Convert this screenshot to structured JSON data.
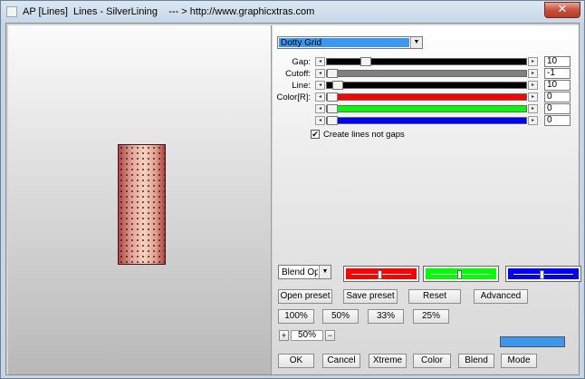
{
  "window": {
    "title": "AP [Lines]  Lines - SilverLining    --- > http://www.graphicxtras.com",
    "close_glyph": "✕"
  },
  "icons": {
    "app": "app-icon",
    "close": "close-icon",
    "dropdown": "chevron-down-icon",
    "left_arrow": "arrow-left-icon",
    "right_arrow": "arrow-right-icon",
    "check": "checkmark-icon"
  },
  "glyphs": {
    "down": "▼",
    "left": "◂",
    "right": "▸",
    "check": "✔"
  },
  "pattern_select": {
    "value": "Dotty Grid",
    "color": "#3a98f0"
  },
  "sliders": [
    {
      "label": "Gap:",
      "value": "10",
      "level": 0.18,
      "color": "#000000"
    },
    {
      "label": "Cutoff:",
      "value": "-1",
      "level": 0.0,
      "color": "#808080"
    },
    {
      "label": "Line:",
      "value": "10",
      "level": 0.03,
      "color": "#000000"
    },
    {
      "label": "Color[R]:",
      "value": "0",
      "level": 0.0,
      "color": "#ff0000"
    },
    {
      "label": "",
      "value": "0",
      "level": 0.0,
      "color": "#00ff00"
    },
    {
      "label": "",
      "value": "0",
      "level": 0.0,
      "color": "#0000ff"
    }
  ],
  "checkbox": {
    "label": "Create lines not gaps",
    "checked": true
  },
  "blend_select": {
    "value": "Blend Opti"
  },
  "color_blend": [
    {
      "color": "#ff0000",
      "level": 0.5
    },
    {
      "color": "#00ff00",
      "level": 0.5
    },
    {
      "color": "#0000ff",
      "level": 0.5
    }
  ],
  "buttons": {
    "open_preset": "Open preset",
    "save_preset": "Save preset",
    "reset": "Reset",
    "advanced": "Advanced",
    "z100": "100%",
    "z50": "50%",
    "z33": "33%",
    "z25": "25%",
    "plus": "+",
    "zoom_value": "50%",
    "minus": "−",
    "ok": "OK",
    "cancel": "Cancel",
    "xtreme": "Xtreme",
    "color": "Color",
    "blend": "Blend",
    "mode": "Mode"
  },
  "swatch_color": "#3a98f0"
}
